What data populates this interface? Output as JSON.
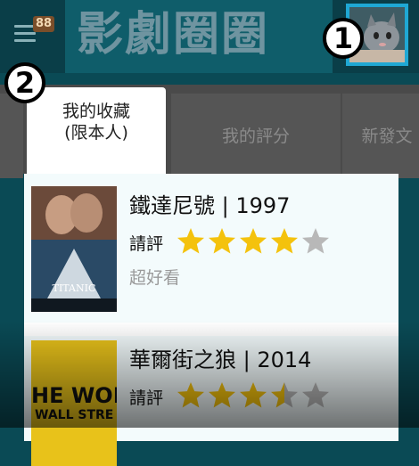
{
  "header": {
    "title": "影劇圈圈",
    "badge_count": "88",
    "avatar": "cat-avatar-icon"
  },
  "markers": {
    "one": "1",
    "two": "2"
  },
  "tabs": [
    {
      "label_line1": "我的收藏",
      "label_line2": "(限本人)",
      "active": true
    },
    {
      "label": "我的評分",
      "active": false
    },
    {
      "label": "新發文",
      "active": false
    }
  ],
  "items": [
    {
      "title": "鐵達尼號 | 1997",
      "rate_label": "請評",
      "rating": 4,
      "rating_max": 5,
      "comment": "超好看",
      "poster_text": "TITANIC"
    },
    {
      "title": "華爾街之狼 | 2014",
      "rate_label": "請評",
      "rating": 3.5,
      "rating_max": 5,
      "comment": "",
      "poster_text_1": "HE WOL",
      "poster_text_2": "WALL STRE"
    }
  ],
  "colors": {
    "star_on": "#f4c20d",
    "star_off": "#b8b8b8",
    "accent": "#1fa8d4"
  }
}
